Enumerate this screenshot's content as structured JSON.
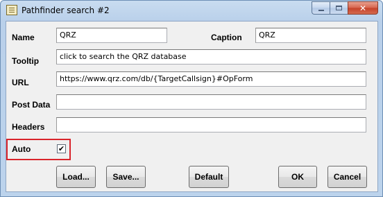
{
  "window": {
    "title": "Pathfinder search #2",
    "close_glyph": "✕"
  },
  "form": {
    "name_label": "Name",
    "name_value": "QRZ",
    "caption_label": "Caption",
    "caption_value": "QRZ",
    "tooltip_label": "Tooltip",
    "tooltip_value": "click to search the QRZ database",
    "url_label": "URL",
    "url_value": "https://www.qrz.com/db/{TargetCallsign}#OpForm",
    "postdata_label": "Post Data",
    "postdata_value": "",
    "headers_label": "Headers",
    "headers_value": "",
    "auto_label": "Auto",
    "auto_checked": true,
    "auto_check_glyph": "✔"
  },
  "buttons": {
    "load": "Load...",
    "save": "Save...",
    "default": "Default",
    "ok": "OK",
    "cancel": "Cancel"
  },
  "colors": {
    "highlight": "#d9242b",
    "client_bg": "#f0f0f0"
  }
}
